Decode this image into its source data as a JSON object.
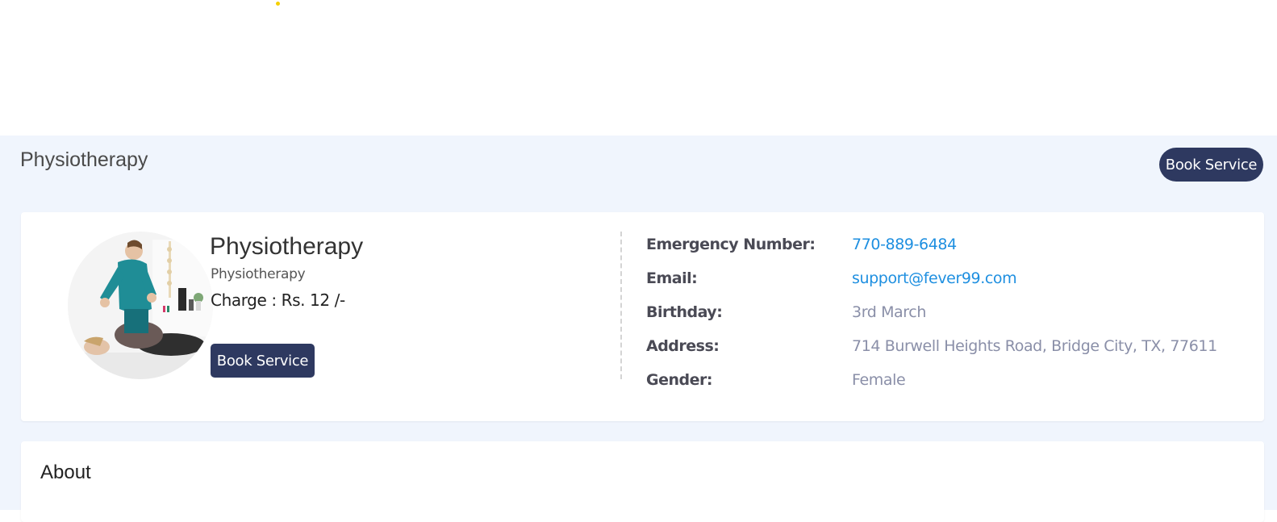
{
  "header": {
    "title": "Physiotherapy",
    "book_button": "Book Service"
  },
  "service": {
    "name": "Physiotherapy",
    "category": "Physiotherapy",
    "charge": "Charge : Rs. 12 /-",
    "book_button": "Book Service",
    "image_alt": "physiotherapist-treating-patient-image"
  },
  "details": [
    {
      "label": "Emergency Number:",
      "value": "770-889-6484"
    },
    {
      "label": "Email:",
      "value": "support@fever99.com"
    },
    {
      "label": "Birthday:",
      "value": "3rd March"
    },
    {
      "label": "Address:",
      "value": "714 Burwell Heights Road, Bridge City, TX, 77611"
    },
    {
      "label": "Gender:",
      "value": "Female"
    }
  ],
  "about": {
    "title": "About"
  },
  "colors": {
    "accent": "#2e3960",
    "link": "#1e8fe0",
    "muted_value": "#8a8fa8",
    "page_bg": "#f0f5fd",
    "loader": "#f5d000"
  }
}
